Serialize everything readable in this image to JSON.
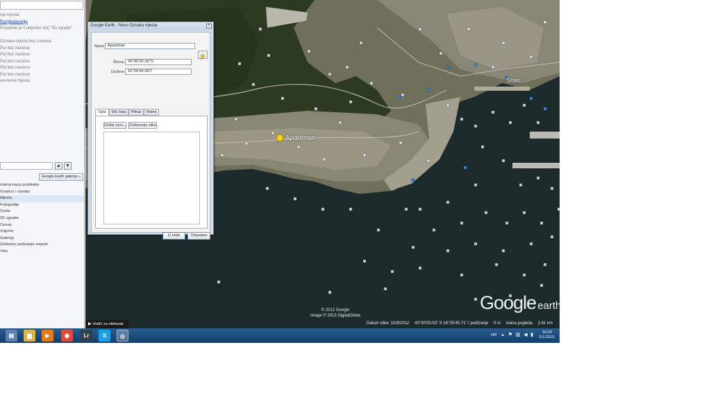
{
  "left_panel": {
    "places": [
      {
        "text": "oja mjesta",
        "link": false
      },
      {
        "text": "Razgledavanje",
        "link": true
      },
      {
        "text": "Provjerite je li uključen sloj \"3D zgrade\"",
        "link": false
      },
      {
        "text": "",
        "link": false
      },
      {
        "text": "Oznaka mjesta bez naslova",
        "link": false
      },
      {
        "text": "Put bez naslova",
        "link": false
      },
      {
        "text": "Put bez naslova",
        "link": false
      },
      {
        "text": "Put bez naslova",
        "link": false
      },
      {
        "text": "Put bez naslova",
        "link": false
      },
      {
        "text": "Put bez naslova",
        "link": false
      },
      {
        "text": "vremena mjesta",
        "link": false
      }
    ],
    "nav_up": "▲",
    "nav_down": "▼",
    "gallery_button": "Google Earth galerija  »",
    "layers": [
      {
        "text": "marna baza podataka",
        "selected": false
      },
      {
        "text": "Granice i oznake",
        "selected": false
      },
      {
        "text": "Mjesta",
        "selected": true
      },
      {
        "text": "Fotografije",
        "selected": false
      },
      {
        "text": "Ceste",
        "selected": false
      },
      {
        "text": "3D zgrade",
        "selected": false
      },
      {
        "text": "Ocean",
        "selected": false
      },
      {
        "text": "Vrijeme",
        "selected": false
      },
      {
        "text": "Galerija",
        "selected": false
      },
      {
        "text": "Globalno podizanje svijesti",
        "selected": false
      },
      {
        "text": "Više",
        "selected": false
      }
    ]
  },
  "dialog": {
    "title": "Google Earth - Novo Oznaka mjesta",
    "close": "×",
    "name_label": "Naziv:",
    "name_value": "Apartman",
    "lat_label": "Širina:",
    "lat_value": "43°30'35.55\"S",
    "lon_label": "Dužina:",
    "lon_value": "16°26'45.06\"I",
    "tabs": [
      "Opis",
      "Stil, boja",
      "Prikaz",
      "Visina"
    ],
    "add_link": "Dodaj vezu...",
    "add_image": "Dodavanje slike...",
    "ok": "U redu",
    "cancel": "Odustani"
  },
  "map": {
    "placemark_label": "Apartman",
    "city_label": "Solin",
    "logo_main": "Google",
    "logo_sub": "earth",
    "copyright_1": "© 2012 Google",
    "copyright_2": "Image © 2013 DigitalGlobe",
    "tour_guide": "▶ Vodič za obilazak",
    "status": {
      "date": "Datum slike: 10/9/2012",
      "coords": "43°30'03.53\" S  16°25'45.71\" I  podizanje",
      "elev": "0 m",
      "eye": "visina pogleda",
      "eye_value": "2.81 km"
    }
  },
  "taskbar": {
    "icons": [
      {
        "name": "document-icon",
        "glyph": "▤",
        "color": "#5a7fb0"
      },
      {
        "name": "folder-icon",
        "glyph": "▆",
        "color": "#d9b44a"
      },
      {
        "name": "media-player-icon",
        "glyph": "▶",
        "color": "#e07b22"
      },
      {
        "name": "chrome-icon",
        "glyph": "◉",
        "color": "#d94b3a"
      },
      {
        "name": "lightroom-icon",
        "glyph": "Lr",
        "color": "#30404f"
      },
      {
        "name": "skype-icon",
        "glyph": "S",
        "color": "#1aa0e6"
      },
      {
        "name": "google-earth-icon",
        "glyph": "◎",
        "color": "#3d6fb6"
      }
    ],
    "lang": "HR",
    "time": "16:23",
    "date": "5.5.2013."
  }
}
